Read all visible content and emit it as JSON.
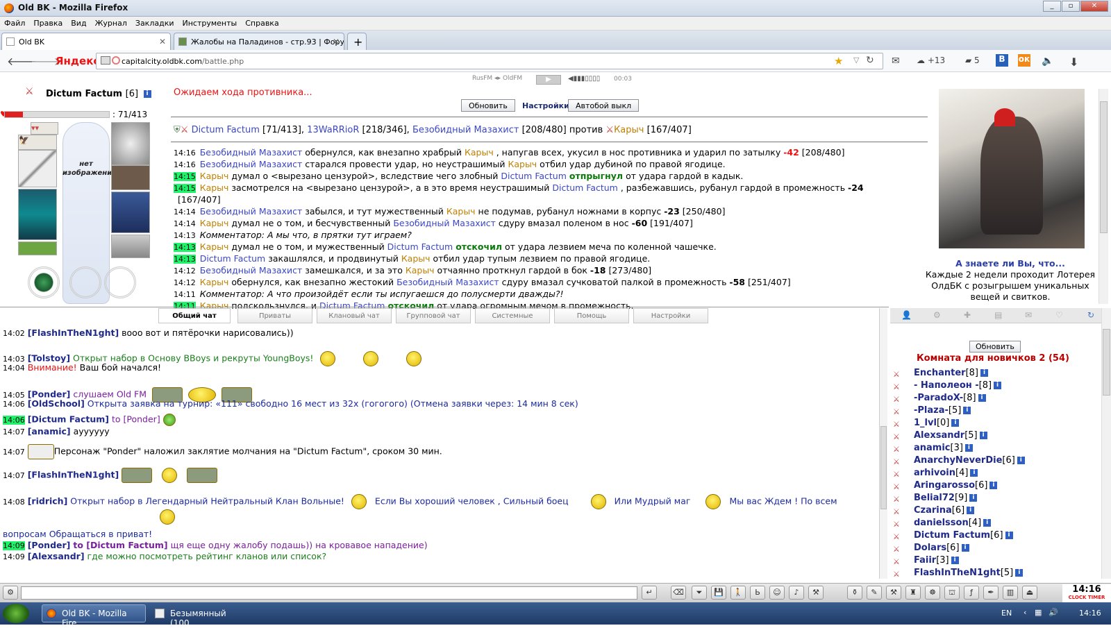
{
  "window": {
    "title": "Old BK - Mozilla Firefox"
  },
  "menu": [
    "Файл",
    "Правка",
    "Вид",
    "Журнал",
    "Закладки",
    "Инструменты",
    "Справка"
  ],
  "tabs": [
    {
      "label": "Old BK"
    },
    {
      "label": "Жалобы на Паладинов - стр.93 | Фору..."
    }
  ],
  "nav": {
    "yandex": "Яндекс",
    "url_domain": "capitalcity.oldbk.com",
    "url_path": "/battle.php",
    "weather": "+13",
    "mail_count": "5"
  },
  "radio": {
    "text": "RusFM ◂▸ OldFM",
    "time": "00:03"
  },
  "player": {
    "name": "Dictum Factum",
    "level": "[6]",
    "hp": "71/413",
    "hp_fraction": 0.17,
    "no_image": "нет изображения"
  },
  "battle": {
    "waiting": "Ожидаем хода противника...",
    "refresh_label": "Обновить",
    "settings_label": "Настройки",
    "autobattle_label": "Автобой выкл",
    "team1": [
      {
        "name": "Dictum Factum",
        "hp": "[71/413]"
      },
      {
        "name": "13WaRRioR",
        "hp": "[218/346]"
      },
      {
        "name": "Безобидный Мазахист",
        "hp": "[208/480]"
      }
    ],
    "versus": "против",
    "team2": [
      {
        "name": "Карыч",
        "hp": "[167/407]"
      }
    ]
  },
  "log": [
    {
      "t": "14:16",
      "hl": false,
      "html": "<span class='blue'>Безобидный Мазахист</span> обернулся, как внезапно храбрый <span class='orange'>Карыч</span> , напугав всех, укусил в нос противника и ударил по затылку <b class='red'>-42</b> [208/480]"
    },
    {
      "t": "14:16",
      "hl": false,
      "html": "<span class='blue'>Безобидный Мазахист</span> старался провести удар, но неустрашимый <span class='orange'>Карыч</span> отбил удар дубиной по правой ягодице."
    },
    {
      "t": "14:15",
      "hl": true,
      "html": "<span class='orange'>Карыч</span> думал о &lt;вырезано цензурой&gt;, вследствие чего злобный <span class='blue'>Dictum Factum</span> <span class='green'>отпрыгнул</span> от удара гардой в кадык."
    },
    {
      "t": "14:15",
      "hl": true,
      "html": "<span class='orange'>Карыч</span> засмотрелся на &lt;вырезано цензурой&gt;, а в это время неустрашимый <span class='blue'>Dictum Factum</span> , разбежавшись, рубанул гардой в промежность <b>-24</b>"
    },
    {
      "t": "",
      "hl": false,
      "html": "[167/407]"
    },
    {
      "t": "14:14",
      "hl": false,
      "html": "<span class='blue'>Безобидный Мазахист</span> забылся, и тут мужественный <span class='orange'>Карыч</span> не подумав, рубанул ножнами в корпус <b>-23</b> [250/480]"
    },
    {
      "t": "14:14",
      "hl": false,
      "html": "<span class='orange'>Карыч</span> думал не о том, и бесчувственный <span class='blue'>Безобидный Мазахист</span> сдуру вмазал поленом в нос <b>-60</b> [191/407]"
    },
    {
      "t": "14:13",
      "hl": false,
      "html": "<i>Комментатор: А мы что, в прятки тут играем?</i>"
    },
    {
      "t": "14:13",
      "hl": true,
      "html": "<span class='orange'>Карыч</span> думал не о том, и мужественный <span class='blue'>Dictum Factum</span> <span class='green'>отскочил</span> от удара лезвием меча по коленной чашечке."
    },
    {
      "t": "14:13",
      "hl": true,
      "html": "<span class='blue'>Dictum Factum</span> закашлялся, и продвинутый <span class='orange'>Карыч</span> отбил удар тупым лезвием по правой ягодице."
    },
    {
      "t": "14:12",
      "hl": false,
      "html": "<span class='blue'>Безобидный Мазахист</span> замешкался, и за это <span class='orange'>Карыч</span> отчаянно проткнул гардой в бок <b>-18</b> [273/480]"
    },
    {
      "t": "14:12",
      "hl": false,
      "html": "<span class='orange'>Карыч</span> обернулся, как внезапно жестокий <span class='blue'>Безобидный Мазахист</span> сдуру вмазал сучковатой палкой в промежность <b>-58</b> [251/407]"
    },
    {
      "t": "14:11",
      "hl": false,
      "html": "<i>Комментатор: А что произойдёт если ты испугаешся до полусмерти дважды?!</i>"
    },
    {
      "t": "14:11",
      "hl": true,
      "html": "<span class='orange'>Карыч</span> подскользнулся, и <span class='blue'>Dictum Factum</span> <span class='green'>отскочил</span> от удара огромным мечом в промежность."
    }
  ],
  "tips": {
    "heading": "А знаете ли Вы, что...",
    "text": "Каждые 2 недели проходит Лотерея ОлдБК с розыгрышем уникальных вещей и свитков."
  },
  "chat_tabs": [
    "Общий чат",
    "Приваты",
    "Клановый чат",
    "Групповой чат",
    "Системные",
    "Помощь",
    "Настройки"
  ],
  "chat": [
    {
      "t": "14:02",
      "nick": "FlashInTheN1ght",
      "msg": "вооо вот и пятёрочки нарисовались))",
      "cls": ""
    },
    {
      "t": "14:03",
      "nick": "Tolstoy",
      "msg": "Открыт набор в Основу BBoys и рекруты YoungBoys!",
      "cls": "green2"
    },
    {
      "t": "14:04",
      "nick": "",
      "msg_pre": "Внимание!",
      "msg": "Ваш бой начался!",
      "cls": ""
    },
    {
      "t": "14:05",
      "nick": "Ponder",
      "msg": "слушаем Old FM",
      "cls": "purple"
    },
    {
      "t": "14:06",
      "nick": "OldSchool",
      "msg": "Открыта заявка на турнир: «111» свободно 16 мест из 32х (гогогого) (Отмена заявки через: 14 мин 8 сек)",
      "cls": "darkblue"
    },
    {
      "t": "14:06",
      "nick": "Dictum Factum",
      "to": "to [Ponder]",
      "msg": "",
      "cls": "purple"
    },
    {
      "t": "14:07",
      "nick": "anamic",
      "msg": "ayyyyyy",
      "cls": ""
    },
    {
      "t": "14:07",
      "nick": "",
      "msg": "Персонаж \"Ponder\" наложил заклятие молчания на \"Dictum Factum\", сроком 30 мин.",
      "cls": ""
    },
    {
      "t": "14:07",
      "nick": "FlashInTheN1ght",
      "msg": "",
      "cls": ""
    },
    {
      "t": "14:08",
      "nick": "ridrich",
      "msg": "Открыт набор в Легендарный Нейтральный Клан Вольные!",
      "msg2": "Если Вы хороший человек , Сильный боец",
      "msg3": "Или Мудрый маг",
      "msg4": "Мы вас Ждем ! По всем",
      "cls": "darkblue"
    },
    {
      "t": "",
      "nick": "",
      "msg": "вопросам Обращаться в приват!",
      "cls": "darkblue"
    },
    {
      "t": "14:09",
      "nick": "Ponder",
      "to": "to [Dictum Factum]",
      "msg": "щя еще одну жалобу подашь)) на кровавое нападение)",
      "cls": "purple"
    },
    {
      "t": "14:09",
      "nick": "Alexsandr",
      "msg": "где можно посмотреть рейтинг кланов или список?",
      "cls": "green2"
    }
  ],
  "room": {
    "refresh_label": "Обновить",
    "title": "Комната для новичков 2 (54)",
    "users": [
      {
        "name": "Enchanter",
        "lvl": "[8]"
      },
      {
        "name": "- Наполеон -",
        "lvl": "[8]"
      },
      {
        "name": "-ParadoX-",
        "lvl": "[8]"
      },
      {
        "name": "-Plaza-",
        "lvl": "[5]"
      },
      {
        "name": "1_lvl",
        "lvl": "[0]"
      },
      {
        "name": "Alexsandr",
        "lvl": "[5]"
      },
      {
        "name": "anamic",
        "lvl": "[3]"
      },
      {
        "name": "AnarchyNeverDie",
        "lvl": "[6]"
      },
      {
        "name": "arhivoin",
        "lvl": "[4]"
      },
      {
        "name": "Aringarosso",
        "lvl": "[6]"
      },
      {
        "name": "Belial72",
        "lvl": "[9]"
      },
      {
        "name": "Czarina",
        "lvl": "[6]"
      },
      {
        "name": "danielsson",
        "lvl": "[4]"
      },
      {
        "name": "Dictum Factum",
        "lvl": "[6]"
      },
      {
        "name": "Dolars",
        "lvl": "[6]"
      },
      {
        "name": "Faiir",
        "lvl": "[3]"
      },
      {
        "name": "FlashInTheN1ght",
        "lvl": "[5]"
      }
    ]
  },
  "clock": {
    "time": "14:16",
    "label1": "CLOCK",
    "label2": "TIMER"
  },
  "taskbar": {
    "items": [
      "Old BK - Mozilla Fire...",
      "Безымянный (100..."
    ],
    "lang": "EN",
    "time": "14:16"
  }
}
